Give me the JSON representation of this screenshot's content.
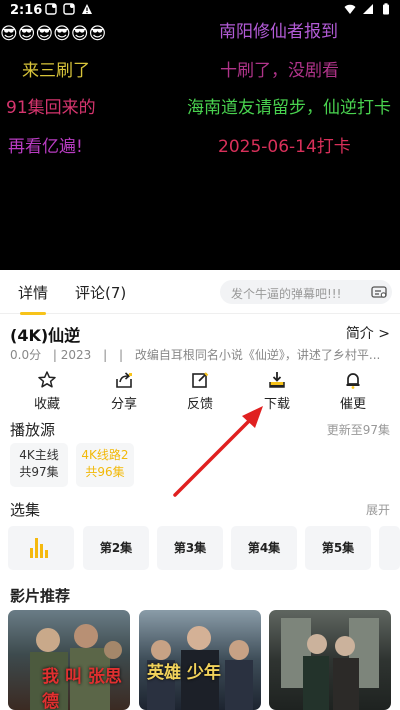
{
  "status_bar": {
    "time": "2:16",
    "icons": [
      "notification-icon",
      "notification-icon",
      "warning-icon",
      "wifi-icon",
      "signal-icon",
      "battery-icon"
    ]
  },
  "video": {
    "danmaku": [
      {
        "text": "😎😎😎😎😎😎",
        "color": "#ffffff"
      },
      {
        "text": "南阳修仙者报到",
        "color": "#b25bd6"
      },
      {
        "text": "来三刷了",
        "color": "#d8c43a"
      },
      {
        "text": "十刷了，没剧看",
        "color": "#b0348a"
      },
      {
        "text": "91集回来的",
        "color": "#d6356e"
      },
      {
        "text": "海南道友请留步，仙逆打卡",
        "color": "#49d24f"
      },
      {
        "text": "再看亿遍!",
        "color": "#b93cc2"
      },
      {
        "text": "2025-06-14打卡",
        "color": "#d8305a"
      }
    ]
  },
  "tabs": {
    "details": "详情",
    "comments": "评论(7)"
  },
  "danmaku_input": {
    "placeholder": "发个牛逼的弹幕吧!!!"
  },
  "show": {
    "title": "(4K)仙逆",
    "intro_label": "简介 >",
    "rating": "0.0分",
    "year": "| 2023",
    "sep": "|",
    "sep2": "|",
    "description": "改编自耳根同名小说《仙逆》，讲述了乡村平..."
  },
  "actions": [
    {
      "label": "收藏",
      "icon": "star-icon"
    },
    {
      "label": "分享",
      "icon": "share-icon"
    },
    {
      "label": "反馈",
      "icon": "edit-icon"
    },
    {
      "label": "下载",
      "icon": "download-icon"
    },
    {
      "label": "催更",
      "icon": "bell-icon"
    }
  ],
  "source": {
    "title": "播放源",
    "update": "更新至97集",
    "items": [
      {
        "line1": "4K主线",
        "line2": "共97集",
        "active": false
      },
      {
        "line1": "4K线路2",
        "line2": "共96集",
        "active": true
      }
    ]
  },
  "episodes": {
    "title": "选集",
    "expand": "展开",
    "items": [
      "第2集",
      "第3集",
      "第4集",
      "第5集"
    ]
  },
  "recommend": {
    "title": "影片推荐",
    "posters": [
      {
        "text": "我 叫 张思德"
      },
      {
        "text": "英雄 少年"
      },
      {
        "text": ""
      }
    ]
  },
  "colors": {
    "accent": "#f7c31a",
    "arrow": "#e02020"
  }
}
